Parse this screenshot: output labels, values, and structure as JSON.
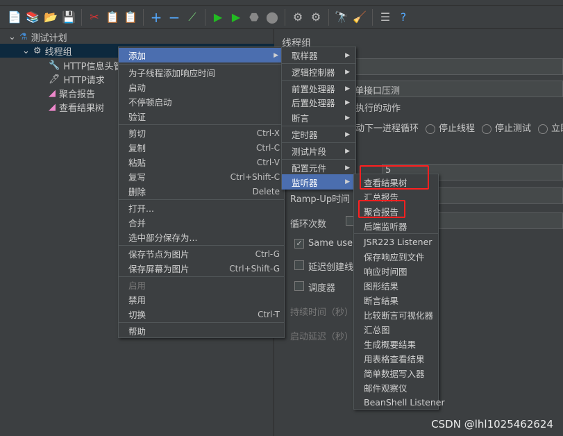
{
  "toolbar": {
    "icons": [
      "new-icon",
      "templates-icon",
      "open-icon",
      "save-icon",
      "cut-icon",
      "copy-icon",
      "paste-icon",
      "expand-icon",
      "collapse-icon",
      "toggle-icon",
      "start-icon",
      "start-no-pause-icon",
      "stop-icon",
      "shutdown-icon",
      "clear-icon",
      "clear-all-icon",
      "search-icon",
      "reset-search-icon",
      "log-viewer-icon",
      "help-icon"
    ]
  },
  "tree": {
    "items": [
      {
        "label": "测试计划"
      },
      {
        "label": "线程组"
      },
      {
        "label": "HTTP信息头管"
      },
      {
        "label": "HTTP请求"
      },
      {
        "label": "聚合报告"
      },
      {
        "label": "查看结果树"
      }
    ]
  },
  "right": {
    "title": "线程组",
    "name_value": "单接口压测",
    "error_section": "执行的动作",
    "radio_continue": "动下一进程循环",
    "radio_stop_thread": "停止线程",
    "radio_stop_test": "停止测试",
    "radio_now": "立即",
    "threads_value": "5",
    "rampup": "Ramp-Up时间（秒）",
    "loop": "循环次数",
    "same_user": "Same user on each iteration",
    "delay": "延迟创建线程直到需要",
    "scheduler": "调度器",
    "duration": "持续时间（秒）",
    "startup_delay": "启动延迟（秒）"
  },
  "context_menu": {
    "add": "添加",
    "add_think": "为子线程添加响应时间",
    "start": "启动",
    "start_no_pause": "不停顿启动",
    "validate": "验证",
    "cut": "剪切",
    "cut_sc": "Ctrl-X",
    "copy": "复制",
    "copy_sc": "Ctrl-C",
    "paste": "粘贴",
    "paste_sc": "Ctrl-V",
    "duplicate": "复写",
    "duplicate_sc": "Ctrl+Shift-C",
    "delete": "删除",
    "delete_sc": "Delete",
    "open": "打开...",
    "merge": "合并",
    "save_selection": "选中部分保存为...",
    "save_node_img": "保存节点为图片",
    "save_node_img_sc": "Ctrl-G",
    "save_screen_img": "保存屏幕为图片",
    "save_screen_img_sc": "Ctrl+Shift-G",
    "enable": "启用",
    "disable": "禁用",
    "toggle": "切换",
    "toggle_sc": "Ctrl-T",
    "help": "帮助"
  },
  "add_menu": {
    "items": [
      "取样器",
      "逻辑控制器",
      "前置处理器",
      "后置处理器",
      "断言",
      "定时器",
      "测试片段",
      "配置元件",
      "监听器"
    ]
  },
  "listener_menu": {
    "items": [
      "查看结果树",
      "汇总报告",
      "聚合报告",
      "后端监听器",
      "JSR223 Listener",
      "保存响应到文件",
      "响应时间图",
      "图形结果",
      "断言结果",
      "比较断言可视化器",
      "汇总图",
      "生成概要结果",
      "用表格查看结果",
      "简单数据写入器",
      "邮件观察仪",
      "BeanShell Listener"
    ]
  },
  "watermark": "CSDN @lhl1025462624",
  "colors": {
    "highlight": "#4b6eaf",
    "annotation": "#ff2020"
  }
}
